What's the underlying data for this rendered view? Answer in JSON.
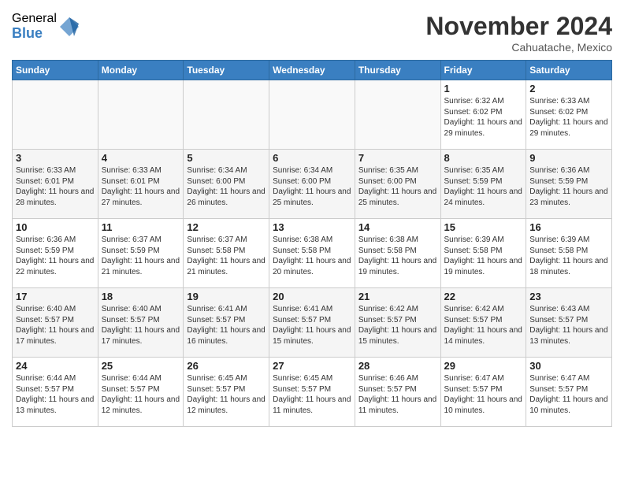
{
  "logo": {
    "general": "General",
    "blue": "Blue"
  },
  "title": "November 2024",
  "location": "Cahuatache, Mexico",
  "weekdays": [
    "Sunday",
    "Monday",
    "Tuesday",
    "Wednesday",
    "Thursday",
    "Friday",
    "Saturday"
  ],
  "weeks": [
    [
      {
        "day": "",
        "info": ""
      },
      {
        "day": "",
        "info": ""
      },
      {
        "day": "",
        "info": ""
      },
      {
        "day": "",
        "info": ""
      },
      {
        "day": "",
        "info": ""
      },
      {
        "day": "1",
        "info": "Sunrise: 6:32 AM\nSunset: 6:02 PM\nDaylight: 11 hours and 29 minutes."
      },
      {
        "day": "2",
        "info": "Sunrise: 6:33 AM\nSunset: 6:02 PM\nDaylight: 11 hours and 29 minutes."
      }
    ],
    [
      {
        "day": "3",
        "info": "Sunrise: 6:33 AM\nSunset: 6:01 PM\nDaylight: 11 hours and 28 minutes."
      },
      {
        "day": "4",
        "info": "Sunrise: 6:33 AM\nSunset: 6:01 PM\nDaylight: 11 hours and 27 minutes."
      },
      {
        "day": "5",
        "info": "Sunrise: 6:34 AM\nSunset: 6:00 PM\nDaylight: 11 hours and 26 minutes."
      },
      {
        "day": "6",
        "info": "Sunrise: 6:34 AM\nSunset: 6:00 PM\nDaylight: 11 hours and 25 minutes."
      },
      {
        "day": "7",
        "info": "Sunrise: 6:35 AM\nSunset: 6:00 PM\nDaylight: 11 hours and 25 minutes."
      },
      {
        "day": "8",
        "info": "Sunrise: 6:35 AM\nSunset: 5:59 PM\nDaylight: 11 hours and 24 minutes."
      },
      {
        "day": "9",
        "info": "Sunrise: 6:36 AM\nSunset: 5:59 PM\nDaylight: 11 hours and 23 minutes."
      }
    ],
    [
      {
        "day": "10",
        "info": "Sunrise: 6:36 AM\nSunset: 5:59 PM\nDaylight: 11 hours and 22 minutes."
      },
      {
        "day": "11",
        "info": "Sunrise: 6:37 AM\nSunset: 5:59 PM\nDaylight: 11 hours and 21 minutes."
      },
      {
        "day": "12",
        "info": "Sunrise: 6:37 AM\nSunset: 5:58 PM\nDaylight: 11 hours and 21 minutes."
      },
      {
        "day": "13",
        "info": "Sunrise: 6:38 AM\nSunset: 5:58 PM\nDaylight: 11 hours and 20 minutes."
      },
      {
        "day": "14",
        "info": "Sunrise: 6:38 AM\nSunset: 5:58 PM\nDaylight: 11 hours and 19 minutes."
      },
      {
        "day": "15",
        "info": "Sunrise: 6:39 AM\nSunset: 5:58 PM\nDaylight: 11 hours and 19 minutes."
      },
      {
        "day": "16",
        "info": "Sunrise: 6:39 AM\nSunset: 5:58 PM\nDaylight: 11 hours and 18 minutes."
      }
    ],
    [
      {
        "day": "17",
        "info": "Sunrise: 6:40 AM\nSunset: 5:57 PM\nDaylight: 11 hours and 17 minutes."
      },
      {
        "day": "18",
        "info": "Sunrise: 6:40 AM\nSunset: 5:57 PM\nDaylight: 11 hours and 17 minutes."
      },
      {
        "day": "19",
        "info": "Sunrise: 6:41 AM\nSunset: 5:57 PM\nDaylight: 11 hours and 16 minutes."
      },
      {
        "day": "20",
        "info": "Sunrise: 6:41 AM\nSunset: 5:57 PM\nDaylight: 11 hours and 15 minutes."
      },
      {
        "day": "21",
        "info": "Sunrise: 6:42 AM\nSunset: 5:57 PM\nDaylight: 11 hours and 15 minutes."
      },
      {
        "day": "22",
        "info": "Sunrise: 6:42 AM\nSunset: 5:57 PM\nDaylight: 11 hours and 14 minutes."
      },
      {
        "day": "23",
        "info": "Sunrise: 6:43 AM\nSunset: 5:57 PM\nDaylight: 11 hours and 13 minutes."
      }
    ],
    [
      {
        "day": "24",
        "info": "Sunrise: 6:44 AM\nSunset: 5:57 PM\nDaylight: 11 hours and 13 minutes."
      },
      {
        "day": "25",
        "info": "Sunrise: 6:44 AM\nSunset: 5:57 PM\nDaylight: 11 hours and 12 minutes."
      },
      {
        "day": "26",
        "info": "Sunrise: 6:45 AM\nSunset: 5:57 PM\nDaylight: 11 hours and 12 minutes."
      },
      {
        "day": "27",
        "info": "Sunrise: 6:45 AM\nSunset: 5:57 PM\nDaylight: 11 hours and 11 minutes."
      },
      {
        "day": "28",
        "info": "Sunrise: 6:46 AM\nSunset: 5:57 PM\nDaylight: 11 hours and 11 minutes."
      },
      {
        "day": "29",
        "info": "Sunrise: 6:47 AM\nSunset: 5:57 PM\nDaylight: 11 hours and 10 minutes."
      },
      {
        "day": "30",
        "info": "Sunrise: 6:47 AM\nSunset: 5:57 PM\nDaylight: 11 hours and 10 minutes."
      }
    ]
  ]
}
